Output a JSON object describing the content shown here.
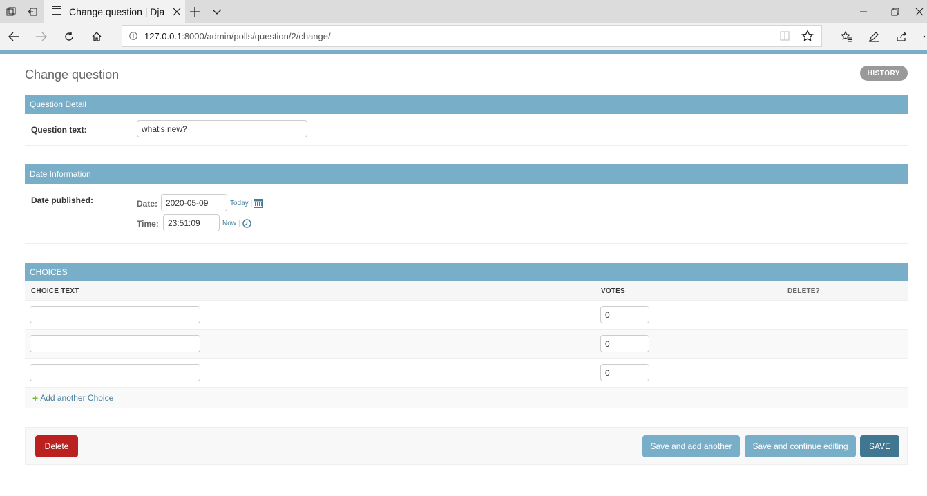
{
  "browser": {
    "tab_title": "Change question | Django site admin",
    "url_host": "127.0.0.1",
    "url_rest": ":8000/admin/polls/question/2/change/"
  },
  "page": {
    "title": "Change question",
    "history_label": "HISTORY"
  },
  "question_detail": {
    "heading": "Question Detail",
    "label": "Question text:",
    "value": "what's new?"
  },
  "date_information": {
    "heading": "Date Information",
    "label": "Date published:",
    "date_label": "Date:",
    "date_value": "2020-05-09",
    "today_label": "Today",
    "time_label": "Time:",
    "time_value": "23:51:09",
    "now_label": "Now"
  },
  "choices": {
    "heading": "CHOICES",
    "columns": [
      "CHOICE TEXT",
      "VOTES",
      "DELETE?"
    ],
    "rows": [
      {
        "text": "",
        "votes": "0"
      },
      {
        "text": "",
        "votes": "0"
      },
      {
        "text": "",
        "votes": "0"
      }
    ],
    "add_label": "Add another Choice"
  },
  "actions": {
    "delete_label": "Delete",
    "save_add_label": "Save and add another",
    "save_continue_label": "Save and continue editing",
    "save_label": "SAVE"
  },
  "colors": {
    "module_header": "#79aec8",
    "delete": "#ba2121",
    "primary": "#417690",
    "link": "#447e9b"
  }
}
